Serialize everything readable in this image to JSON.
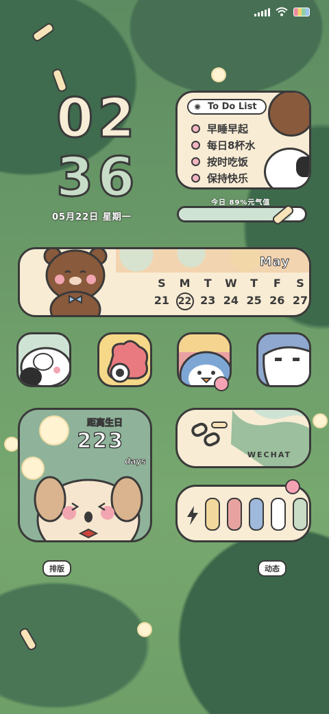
{
  "status_bar": {
    "signal_icon": "signal-bars-icon",
    "wifi_icon": "wifi-icon",
    "battery_icon": "battery-icon"
  },
  "clock": {
    "hours": "02",
    "minutes": "36",
    "date": "05月22日  星期一"
  },
  "todo": {
    "title": "To Do List",
    "items": [
      "早睡早起",
      "每日8杯水",
      "按时吃饭",
      "保持快乐"
    ]
  },
  "energy": {
    "label": "今日  89%元气值",
    "fill_percent": 89
  },
  "calendar": {
    "month": "May",
    "weekdays": [
      "S",
      "M",
      "T",
      "W",
      "T",
      "F",
      "S"
    ],
    "days": [
      "21",
      "22",
      "23",
      "24",
      "25",
      "26",
      "27"
    ],
    "today": "22"
  },
  "apps": [
    {
      "name": "panda-app"
    },
    {
      "name": "camera-app"
    },
    {
      "name": "penguin-app"
    },
    {
      "name": "seal-app"
    }
  ],
  "countdown": {
    "label": "距离生日",
    "number": "223",
    "unit": "days"
  },
  "wechat": {
    "label": "WECHAT"
  },
  "tags": {
    "layout": "排版",
    "dynamic": "动态"
  },
  "colors": {
    "accent_green": "#cfe3d4",
    "card": "#f8ecd5",
    "outline": "#3a3a3a",
    "pill_colors": [
      "#f2d89c",
      "#e8a3a0",
      "#9fb9dc",
      "#ffffff",
      "#c9dcc6"
    ]
  }
}
